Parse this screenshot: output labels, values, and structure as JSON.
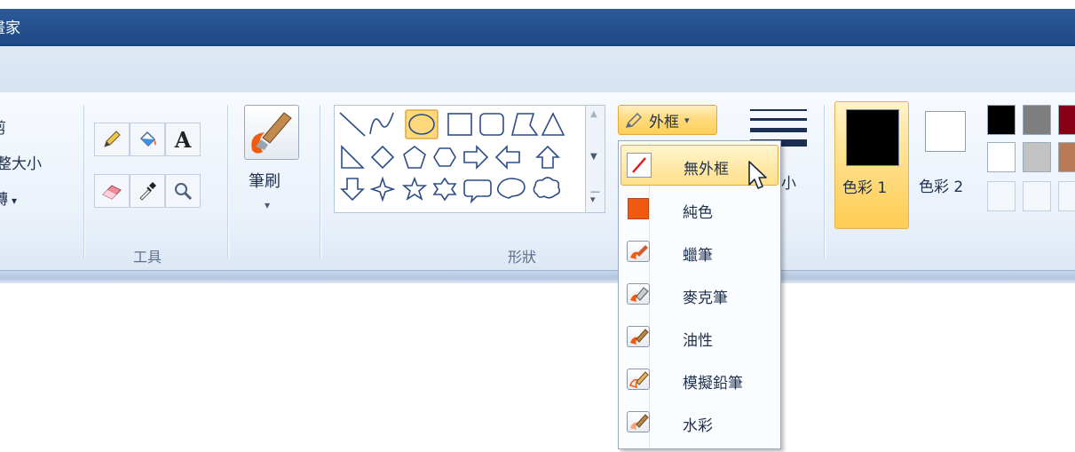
{
  "window": {
    "title": "小畫家"
  },
  "image_group": {
    "crop": "剪",
    "resize": "整大小",
    "rotate": "轉"
  },
  "tools": {
    "label": "工具"
  },
  "brushes": {
    "label": "筆刷"
  },
  "shapes": {
    "label": "形狀",
    "items": [
      "line",
      "curve",
      "oval",
      "rectangle",
      "rounded-rectangle",
      "polygon",
      "triangle",
      "right-triangle",
      "diamond",
      "pentagon",
      "hexagon",
      "right-arrow",
      "left-arrow",
      "up-arrow",
      "down-arrow",
      "four-point-star",
      "five-point-star",
      "six-point-star",
      "rounded-callout",
      "oval-callout",
      "cloud-callout"
    ]
  },
  "outline": {
    "label": "外框",
    "menu": [
      {
        "label": "無外框",
        "icon": "no-outline-icon",
        "selected": true
      },
      {
        "label": "純色",
        "icon": "solid-color-icon"
      },
      {
        "label": "蠟筆",
        "icon": "crayon-icon"
      },
      {
        "label": "麥克筆",
        "icon": "marker-icon"
      },
      {
        "label": "油性",
        "icon": "oil-brush-icon"
      },
      {
        "label": "模擬鉛筆",
        "icon": "natural-pencil-icon"
      },
      {
        "label": "水彩",
        "icon": "watercolor-icon"
      }
    ]
  },
  "size": {
    "label": "小"
  },
  "colors": {
    "color1_label": "色彩 1",
    "color2_label": "色彩 2",
    "color1": "#000000",
    "color2": "#ffffff",
    "palette": [
      "#000000",
      "#7f7f7f",
      "#880015",
      "#ffffff",
      "#c3c3c3",
      "#b97a57"
    ]
  },
  "accent": "#f25a0d"
}
